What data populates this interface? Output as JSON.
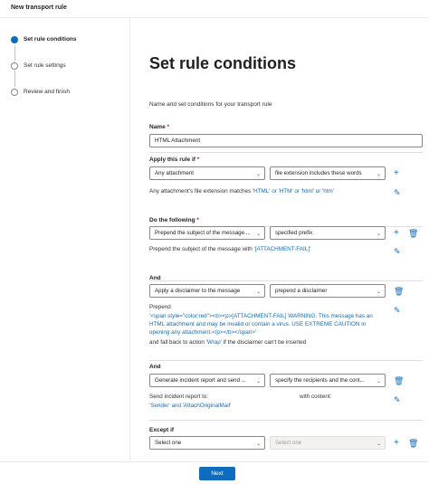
{
  "window": {
    "title": "New transport rule"
  },
  "steps": [
    {
      "label": "Set rule conditions",
      "active": true
    },
    {
      "label": "Set rule settings",
      "active": false
    },
    {
      "label": "Review and finish",
      "active": false
    }
  ],
  "page": {
    "title": "Set rule conditions",
    "description": "Name and set conditions for your transport rule"
  },
  "name": {
    "label": "Name",
    "required_mark": "*",
    "value": "HTML Attachment"
  },
  "apply_if": {
    "label": "Apply this rule if",
    "required_mark": "*",
    "condition": "Any attachment",
    "sub_condition": "file extension includes these words",
    "summary_prefix": "Any attachment's file extension matches ",
    "summary_values": "'HTML' or 'HTM' or 'html' or 'htm'"
  },
  "do_following": {
    "label": "Do the following",
    "required_mark": "*",
    "action": "Prepend the subject of the message...",
    "sub_action": "specified prefix",
    "summary_prefix": "Prepend the subject of the message with ",
    "summary_value": "'[ATTACHMENT-FAIL]'"
  },
  "and_1": {
    "label": "And",
    "action": "Apply a disclaimer to the message",
    "sub_action": "prepend a disclaimer",
    "summary_label": "Prepend",
    "disclaimer_lines": [
      "'<span style=\"color:red\"><b><p>[ATTACHMENT-FAIL] WARNING. This message has an",
      "HTML attachment and may be invalid or contain a virus. USE EXTREME CAUTION in",
      "opening any attachment.</p></b></span>'"
    ],
    "fallback_prefix": "and fall back to action ",
    "fallback_value": "'Wrap'",
    "fallback_suffix": " if the disclaimer can't be inserted"
  },
  "and_2": {
    "label": "And",
    "action": "Generate incident report and send ...",
    "sub_action": "specify the recipients and the cont...",
    "send_label": "Send incident report to:",
    "content_label": "with content:",
    "recipients": "'Sender' and 'AttachOriginalMail'"
  },
  "except_if": {
    "label": "Except if",
    "condition": "Select one",
    "sub_condition": "Select one"
  },
  "footer": {
    "next_label": "Next"
  },
  "colors": {
    "accent": "#0f6cbd",
    "required": "#a4262c"
  },
  "icons": {
    "add": "plus-icon",
    "delete": "trash-icon",
    "edit": "pencil-icon",
    "dropdown": "chevron-down-icon"
  }
}
